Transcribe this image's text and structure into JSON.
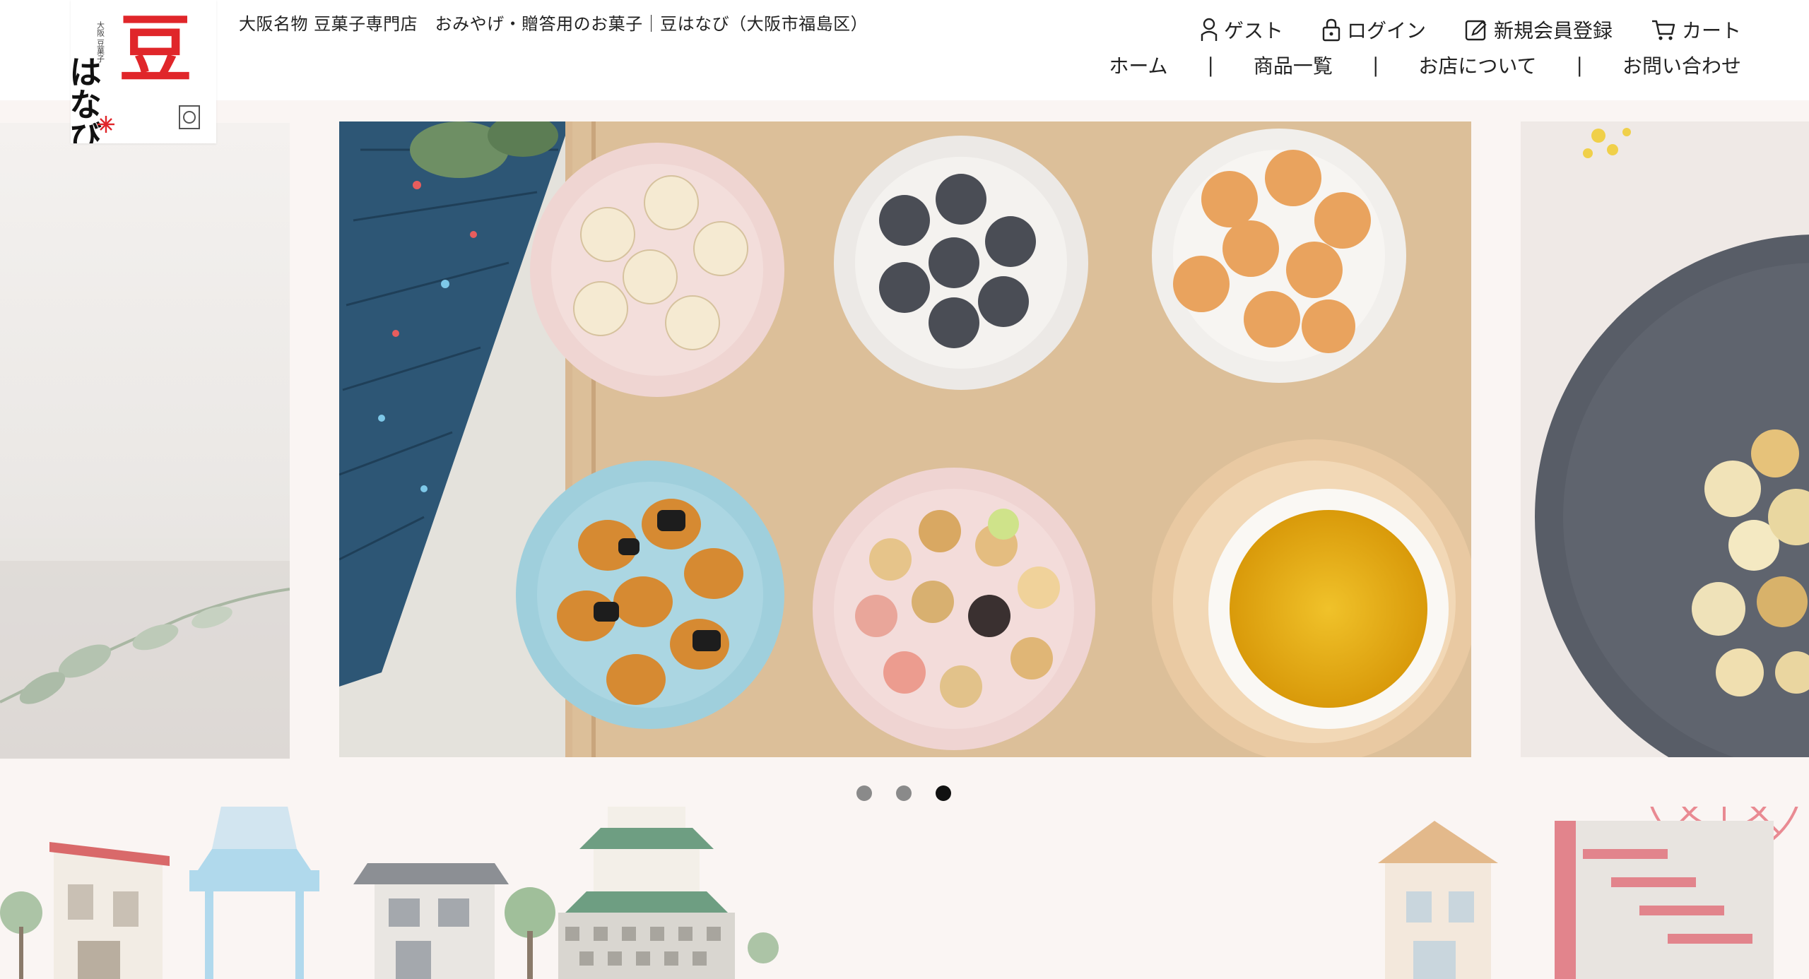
{
  "logo": {
    "text_main": "豆",
    "text_sub": "はなび",
    "small_text": "大阪 豆菓子"
  },
  "header": {
    "tagline": "大阪名物 豆菓子専門店　おみやげ・贈答用のお菓子｜豆はなび（大阪市福島区）"
  },
  "user_menu": [
    {
      "label": "ゲスト",
      "icon": "person-icon"
    },
    {
      "label": "ログイン",
      "icon": "lock-icon"
    },
    {
      "label": "新規会員登録",
      "icon": "register-icon"
    },
    {
      "label": "カート",
      "icon": "cart-icon"
    }
  ],
  "nav": [
    {
      "label": "ホーム"
    },
    {
      "label": "商品一覧"
    },
    {
      "label": "お店について"
    },
    {
      "label": "お問い合わせ"
    }
  ],
  "nav_separator": "|",
  "slider": {
    "dot_count": 3,
    "active_index": 2
  },
  "colors": {
    "brand_red": "#e0262a",
    "background": "#faf5f3",
    "dot_active": "#111111",
    "dot_inactive": "#8a8a8a"
  }
}
